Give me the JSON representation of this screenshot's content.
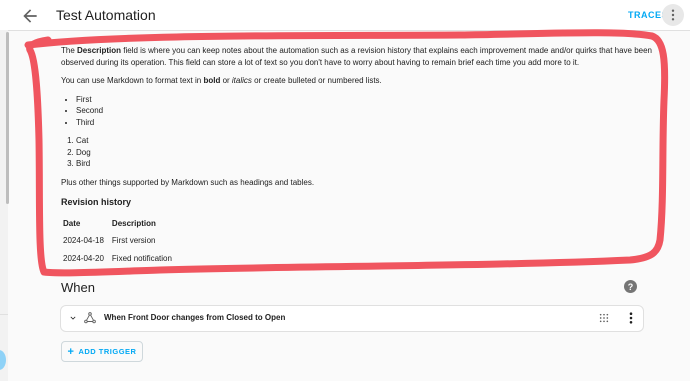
{
  "header": {
    "title": "Test Automation",
    "traces_label": "TRACES"
  },
  "description": {
    "p1_pre": "The ",
    "p1_bold": "Description",
    "p1_post": " field is where you can keep notes about the automation such as a revision history that explains each improvement made and/or quirks that have been observed during its operation. This field can store a lot of text so you don't have to worry about having to remain brief each time you add more to it.",
    "p2_pre": "You can use Markdown to format text in ",
    "p2_bold": "bold",
    "p2_mid": " or ",
    "p2_italic": "italics",
    "p2_post": " or create bulleted or numbered lists.",
    "bullets": [
      "First",
      "Second",
      "Third"
    ],
    "numbered": [
      "Cat",
      "Dog",
      "Bird"
    ],
    "p3": "Plus other things supported by Markdown such as headings and tables.",
    "heading": "Revision history",
    "table": {
      "headers": [
        "Date",
        "Description"
      ],
      "rows": [
        [
          "2024-04-18",
          "First version"
        ],
        [
          "2024-04-20",
          "Fixed notification"
        ]
      ]
    }
  },
  "when": {
    "title": "When",
    "trigger_label": "When Front Door changes from Closed to Open",
    "add_trigger_label": "ADD TRIGGER"
  },
  "colors": {
    "accent": "#03a9f4",
    "annotation": "#f0555f"
  },
  "icons": [
    "arrow-left-icon",
    "dots-vertical-icon",
    "help-icon",
    "chevron-down-icon",
    "trigger-state-icon",
    "drag-handle-icon",
    "plus-icon"
  ]
}
